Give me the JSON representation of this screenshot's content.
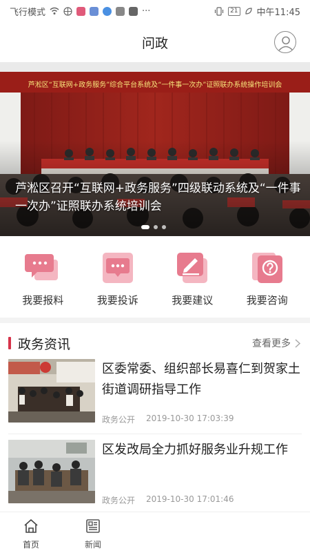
{
  "status_bar": {
    "mode": "飞行模式",
    "battery": "21",
    "time": "中午11:45",
    "more": "···"
  },
  "header": {
    "title": "问政"
  },
  "banner": {
    "headline": "芦淞区召开“互联网+政务服务”四级联动系统及“一件事一次办”证照联办系统培训会",
    "stage_banner_text": "芦淞区“互联网+政务服务”综合平台系统及“一件事一次办”证照联办系统操作培训会"
  },
  "actions": [
    {
      "label": "我要报料",
      "icon": "chat-bubble-icon"
    },
    {
      "label": "我要投诉",
      "icon": "complaint-icon"
    },
    {
      "label": "我要建议",
      "icon": "edit-pen-icon"
    },
    {
      "label": "我要咨询",
      "icon": "question-icon"
    }
  ],
  "section": {
    "title": "政务资讯",
    "more_label": "查看更多"
  },
  "news": [
    {
      "title": "区委常委、组织部长易喜仁到贺家土街道调研指导工作",
      "category": "政务公开",
      "time": "2019-10-30 17:03:39"
    },
    {
      "title": "区发改局全力抓好服务业升规工作",
      "category": "政务公开",
      "time": "2019-10-30 17:01:46"
    }
  ],
  "tabs": [
    {
      "label": "首页",
      "icon": "home-icon"
    },
    {
      "label": "新闻",
      "icon": "news-icon"
    }
  ],
  "colors": {
    "accent": "#d6334a",
    "icon_pink": "#e77b8e",
    "icon_pink_light": "#f4b6c1"
  }
}
